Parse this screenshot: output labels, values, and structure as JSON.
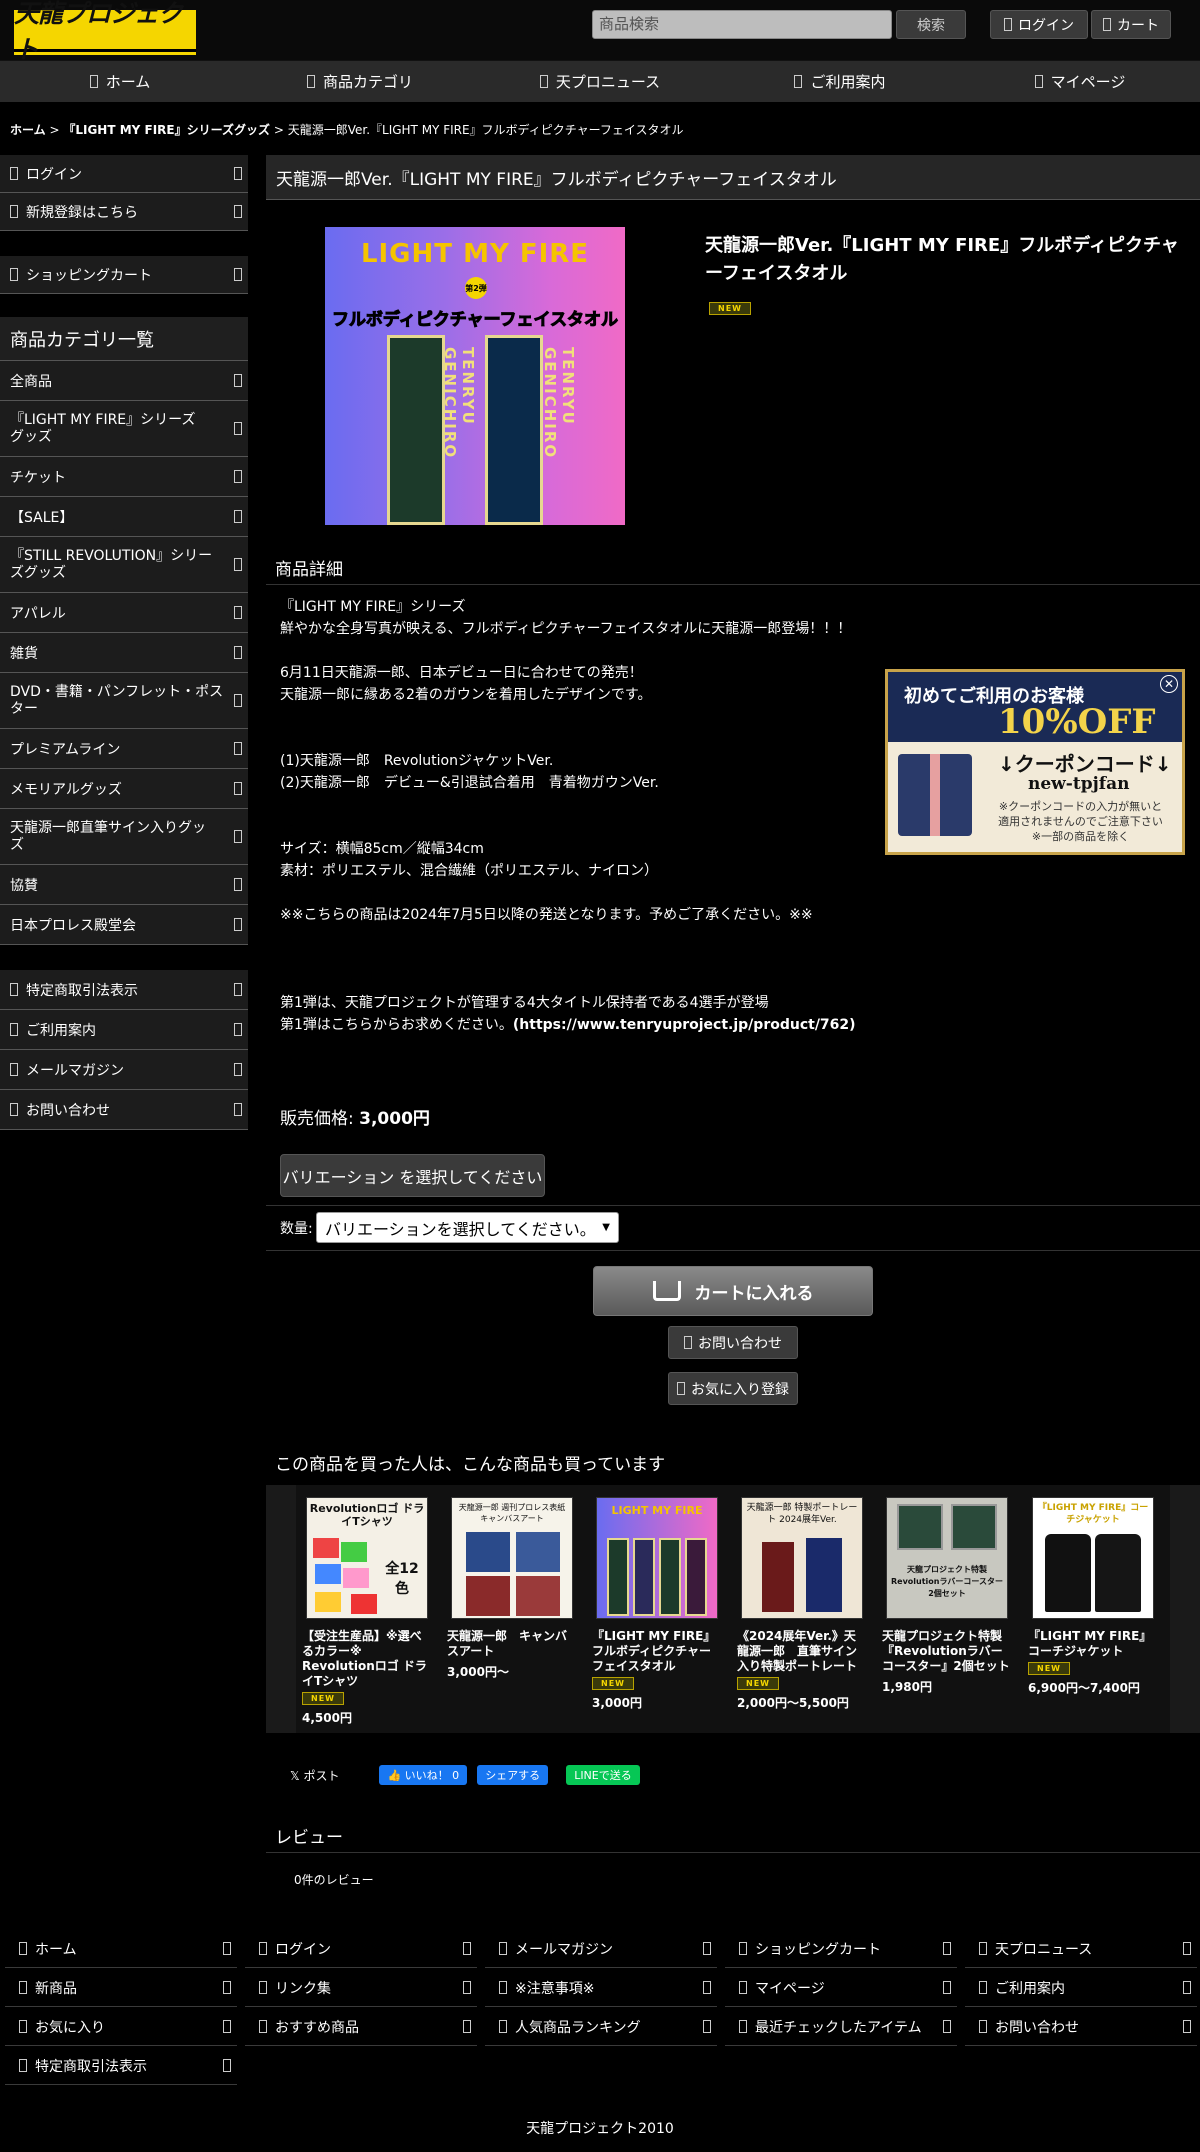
{
  "header": {
    "logo_text": "天龍プロジェクト",
    "search_placeholder": "商品検索",
    "search_button": "検索",
    "login": "ログイン",
    "cart": "カート"
  },
  "gnav": [
    "ホーム",
    "商品カテゴリ",
    "天プロニュース",
    "ご利用案内",
    "マイページ"
  ],
  "breadcrumb": {
    "home": "ホーム",
    "category": "『LIGHT MY FIRE』シリーズグッズ",
    "current": "天龍源一郎Ver.『LIGHT MY FIRE』フルボディピクチャーフェイスタオル",
    "sep": " > "
  },
  "sidebar": {
    "account": [
      "ログイン",
      "新規登録はこちら"
    ],
    "cart": "ショッピングカート",
    "category_title": "商品カテゴリ一覧",
    "categories": [
      "全商品",
      "『LIGHT MY FIRE』シリーズグッズ",
      "チケット",
      "【SALE】",
      "『STILL REVOLUTION』シリーズグッズ",
      "アパレル",
      "雑貨",
      "DVD・書籍・パンフレット・ポスター",
      "プレミアムライン",
      "メモリアルグッズ",
      "天龍源一郎直筆サイン入りグッズ",
      "協賛",
      "日本プロレス殿堂会"
    ],
    "info": [
      "特定商取引法表示",
      "ご利用案内",
      "メールマガジン",
      "お問い合わせ"
    ]
  },
  "product": {
    "title_bar": "天龍源一郎Ver.『LIGHT MY FIRE』フルボディピクチャーフェイスタオル",
    "name": "天龍源一郎Ver.『LIGHT MY FIRE』フルボディピクチャーフェイスタオル",
    "new_badge": "NEW",
    "image_text": {
      "title": "LIGHT MY FIRE",
      "badge": "第2弾",
      "subtitle": "フルボディピクチャーフェイスタオル",
      "name_left": "TENRYU GENICHIRO",
      "name_right": "TENRYU GENICHIRO"
    },
    "detail_heading": "商品詳細",
    "description": [
      "『LIGHT MY FIRE』シリーズ",
      "鮮やかな全身写真が映える、フルボディピクチャーフェイスタオルに天龍源一郎登場！！！",
      "",
      "6月11日天龍源一郎、日本デビュー日に合わせての発売！",
      "天龍源一郎に縁ある2着のガウンを着用したデザインです。",
      "",
      "",
      "(1)天龍源一郎　RevolutionジャケットVer.",
      "(2)天龍源一郎　デビュー&引退試合着用　青着物ガウンVer.",
      "",
      "",
      "サイズ：横幅85cm／縦幅34cm",
      "素材：ポリエステル、混合繊維（ポリエステル、ナイロン）",
      "",
      "※※こちらの商品は2024年7月5日以降の発送となります。予めご了承ください。※※",
      "",
      "",
      "",
      "第1弾は、天龍プロジェクトが管理する4大タイトル保持者である4選手が登場",
      "第1弾はこちらからお求めください。"
    ],
    "link_url": "(https://www.tenryuproject.jp/product/762)",
    "price_label": "販売価格: ",
    "price": "3,000円",
    "variation_button": "バリエーション を選択してください",
    "qty_label": "数量:",
    "qty_select": "バリエーションを選択してください。",
    "add_to_cart": "カートに入れる",
    "contact": "お問い合わせ",
    "favorite": "お気に入り登録"
  },
  "coupon": {
    "first": "初めてご利用のお客様",
    "discount": "10%OFF",
    "code_label": "↓クーポンコード↓",
    "code": "new-tpjfan",
    "note1": "※クーポンコードの入力が無いと",
    "note2": "適用されませんのでご注意下さい",
    "note3": "※一部の商品を除く"
  },
  "also_bought": {
    "heading": "この商品を買った人は、こんな商品も買っています",
    "items": [
      {
        "name": "【受注生産品】※選べるカラー※　Revolutionロゴ ドライTシャツ",
        "new": "NEW",
        "price": "4,500円",
        "img_text": "Revolutionロゴ ドライTシャツ",
        "img_sub": "全12色"
      },
      {
        "name": "天龍源一郎　キャンバスアート",
        "new": "",
        "price": "3,000円〜",
        "img_text": "天龍源一郎 週刊プロレス表紙キャンバスアート",
        "img_sub": ""
      },
      {
        "name": "『LIGHT MY FIRE』フルボディピクチャーフェイスタオル",
        "new": "NEW",
        "price": "3,000円",
        "img_text": "LIGHT MY FIRE",
        "img_sub": ""
      },
      {
        "name": "《2024展年Ver.》天龍源一郎　直筆サイン入り特製ポートレート",
        "new": "NEW",
        "price": "2,000円〜5,500円",
        "img_text": "天龍源一郎 特製ポートレート 2024展年Ver.",
        "img_sub": ""
      },
      {
        "name": "天龍プロジェクト特製『Revolutionラバーコースター』2個セット",
        "new": "",
        "price": "1,980円",
        "img_text": "天龍プロジェクト特製 Revolutionラバーコースター 2個セット",
        "img_sub": ""
      },
      {
        "name": "『LIGHT MY FIRE』コーチジャケット",
        "new": "NEW",
        "price": "6,900円〜7,400円",
        "img_text": "『LIGHT MY FIRE』コーチジャケット",
        "img_sub": ""
      }
    ]
  },
  "share": {
    "x_post": "𝕏 ポスト",
    "fb_like": "👍 いいね！ 0",
    "fb_share": "シェアする",
    "line": "LINEで送る"
  },
  "review": {
    "heading": "レビュー",
    "count": "0件のレビュー"
  },
  "footer": {
    "items": [
      "ホーム",
      "ログイン",
      "メールマガジン",
      "ショッピングカート",
      "天プロニュース",
      "新商品",
      "リンク集",
      "※注意事項※",
      "マイページ",
      "ご利用案内",
      "お気に入り",
      "おすすめ商品",
      "人気商品ランキング",
      "最近チェックしたアイテム",
      "お問い合わせ",
      "特定商取引法表示"
    ],
    "copyright": "天龍プロジェクト2010"
  },
  "colors": {
    "logo_yellow": "#f5d600",
    "background": "#000000",
    "panel": "#1c1c1c"
  }
}
